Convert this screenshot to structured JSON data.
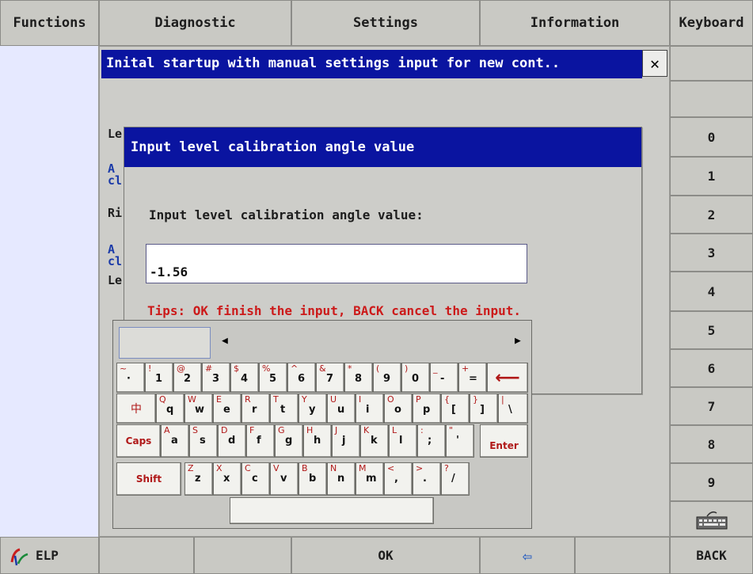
{
  "tabs": [
    "Functions",
    "Diagnostic",
    "Settings",
    "Information",
    "Keyboard"
  ],
  "dialog": {
    "title": "Inital startup with manual settings input for new cont..",
    "close_glyph": "✕",
    "bg_rows": [
      {
        "text": "Le",
        "color": "dark"
      },
      {
        "text": "A",
        "color": "blue"
      },
      {
        "text": "cl",
        "color": "blue"
      },
      {
        "text": "Ri",
        "color": "dark"
      },
      {
        "text": "A",
        "color": "blue"
      },
      {
        "text": "cl",
        "color": "blue"
      },
      {
        "text": "Le",
        "color": "dark"
      }
    ]
  },
  "input_dialog": {
    "title": "Input level calibration angle value",
    "label": "Input level calibration angle value:",
    "value": "-1.56",
    "tips": "Tips: OK finish the input, BACK cancel the input."
  },
  "right_column": [
    "",
    "",
    "0",
    "1",
    "2",
    "3",
    "4",
    "5",
    "6",
    "7",
    "8",
    "9"
  ],
  "bottom_bar": {
    "elp": "ELP",
    "ok": "OK",
    "back": "BACK",
    "arrow_glyph": "⇦"
  },
  "keyboard": {
    "left_arrow": "◀",
    "right_arrow": "▶",
    "row1": [
      {
        "top": "~",
        "bot": "·"
      },
      {
        "top": "!",
        "bot": "1"
      },
      {
        "top": "@",
        "bot": "2"
      },
      {
        "top": "#",
        "bot": "3"
      },
      {
        "top": "$",
        "bot": "4"
      },
      {
        "top": "%",
        "bot": "5"
      },
      {
        "top": "^",
        "bot": "6"
      },
      {
        "top": "&",
        "bot": "7"
      },
      {
        "top": "*",
        "bot": "8"
      },
      {
        "top": "(",
        "bot": "9"
      },
      {
        "top": ")",
        "bot": "0"
      },
      {
        "top": "_",
        "bot": "-"
      },
      {
        "top": "+",
        "bot": "="
      }
    ],
    "backspace_glyph": "⟵",
    "lang_key": "中",
    "row2": [
      {
        "top": "Q",
        "bot": "q"
      },
      {
        "top": "W",
        "bot": "w"
      },
      {
        "top": "E",
        "bot": "e"
      },
      {
        "top": "R",
        "bot": "r"
      },
      {
        "top": "T",
        "bot": "t"
      },
      {
        "top": "Y",
        "bot": "y"
      },
      {
        "top": "U",
        "bot": "u"
      },
      {
        "top": "I",
        "bot": "i"
      },
      {
        "top": "O",
        "bot": "o"
      },
      {
        "top": "P",
        "bot": "p"
      },
      {
        "top": "{",
        "bot": "["
      },
      {
        "top": "}",
        "bot": "]"
      },
      {
        "top": "|",
        "bot": "\\"
      }
    ],
    "caps_key": "Caps",
    "row3": [
      {
        "top": "A",
        "bot": "a"
      },
      {
        "top": "S",
        "bot": "s"
      },
      {
        "top": "D",
        "bot": "d"
      },
      {
        "top": "F",
        "bot": "f"
      },
      {
        "top": "G",
        "bot": "g"
      },
      {
        "top": "H",
        "bot": "h"
      },
      {
        "top": "J",
        "bot": "j"
      },
      {
        "top": "K",
        "bot": "k"
      },
      {
        "top": "L",
        "bot": "l"
      },
      {
        "top": ":",
        "bot": ";"
      },
      {
        "top": "\"",
        "bot": "'"
      }
    ],
    "enter_key": "Enter",
    "shift_key": "Shift",
    "row4": [
      {
        "top": "Z",
        "bot": "z"
      },
      {
        "top": "X",
        "bot": "x"
      },
      {
        "top": "C",
        "bot": "c"
      },
      {
        "top": "V",
        "bot": "v"
      },
      {
        "top": "B",
        "bot": "b"
      },
      {
        "top": "N",
        "bot": "n"
      },
      {
        "top": "M",
        "bot": "m"
      },
      {
        "top": "<",
        "bot": ","
      },
      {
        "top": ">",
        "bot": "."
      },
      {
        "top": "?",
        "bot": "/"
      }
    ]
  },
  "colors": {
    "title_bar": "#0a14a0",
    "tips": "#cc1a1a",
    "left_panel": "#e6e9ff"
  }
}
